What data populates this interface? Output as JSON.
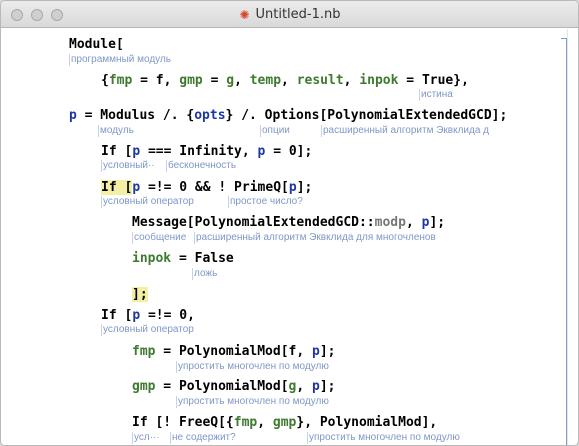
{
  "window": {
    "title": "Untitled-1.nb"
  },
  "code": {
    "l1": {
      "t0": "Module["
    },
    "l1_ann": [
      "программный модуль"
    ],
    "l2": {
      "t0": "{",
      "t1": "fmp",
      "t2": " = f, ",
      "t3": "gmp",
      "t4": " = ",
      "t5": "g",
      "t6": ", ",
      "t7": "temp",
      "t8": ", ",
      "t9": "result",
      "t10": ", ",
      "t11": "inpok",
      "t12": " = True},"
    },
    "l2_ann": [
      "истина"
    ],
    "l3": {
      "t0": "p",
      "t1": " = Modulus /. {",
      "t2": "opts",
      "t3": "} /. Options[PolynomialExtendedGCD];"
    },
    "l3_ann": [
      "модуль",
      "опции",
      "расширенный алгоритм Эквклида д"
    ],
    "l4": {
      "t0": "If [",
      "t1": "p",
      "t2": " === Infinity, ",
      "t3": "p",
      "t4": " = 0];"
    },
    "l4_ann": [
      "условный··",
      "бесконечность"
    ],
    "l5": {
      "t0": "If [",
      "t1": "p",
      "t2": " =!= 0 && ! PrimeQ[",
      "t3": "p",
      "t4": "];"
    },
    "l5_ann": [
      "условный оператор",
      "простое число?"
    ],
    "l6": {
      "t0": "Message[PolynomialExtendedGCD::",
      "t1": "modp",
      "t2": ", ",
      "t3": "p",
      "t4": "];"
    },
    "l6_ann": [
      "сообщение",
      "расширенный алгоритм Эквклида для многочленов"
    ],
    "l7": {
      "t0": "inpok",
      "t1": " = False"
    },
    "l7_ann": [
      "ложь"
    ],
    "l8": {
      "t0": "];"
    },
    "l9": {
      "t0": "If [",
      "t1": "p",
      "t2": " =!= 0,"
    },
    "l9_ann": [
      "условный оператор"
    ],
    "l10": {
      "t0": "fmp",
      "t1": " = PolynomialMod[f, ",
      "t2": "p",
      "t3": "];"
    },
    "l10_ann": [
      "упростить многочлен по модулю"
    ],
    "l11": {
      "t0": "gmp",
      "t1": " = PolynomialMod[",
      "t2": "g",
      "t3": ", ",
      "t4": "p",
      "t5": "];"
    },
    "l11_ann": [
      "упростить многочлен по модулю"
    ],
    "l12": {
      "t0": "If [! FreeQ[{",
      "t1": "fmp",
      "t2": ", ",
      "t3": "gmp",
      "t4": "}, PolynomialMod],"
    },
    "l12_ann": [
      "усл···",
      "не содержит?",
      "упростить многочлен по модулю"
    ]
  }
}
